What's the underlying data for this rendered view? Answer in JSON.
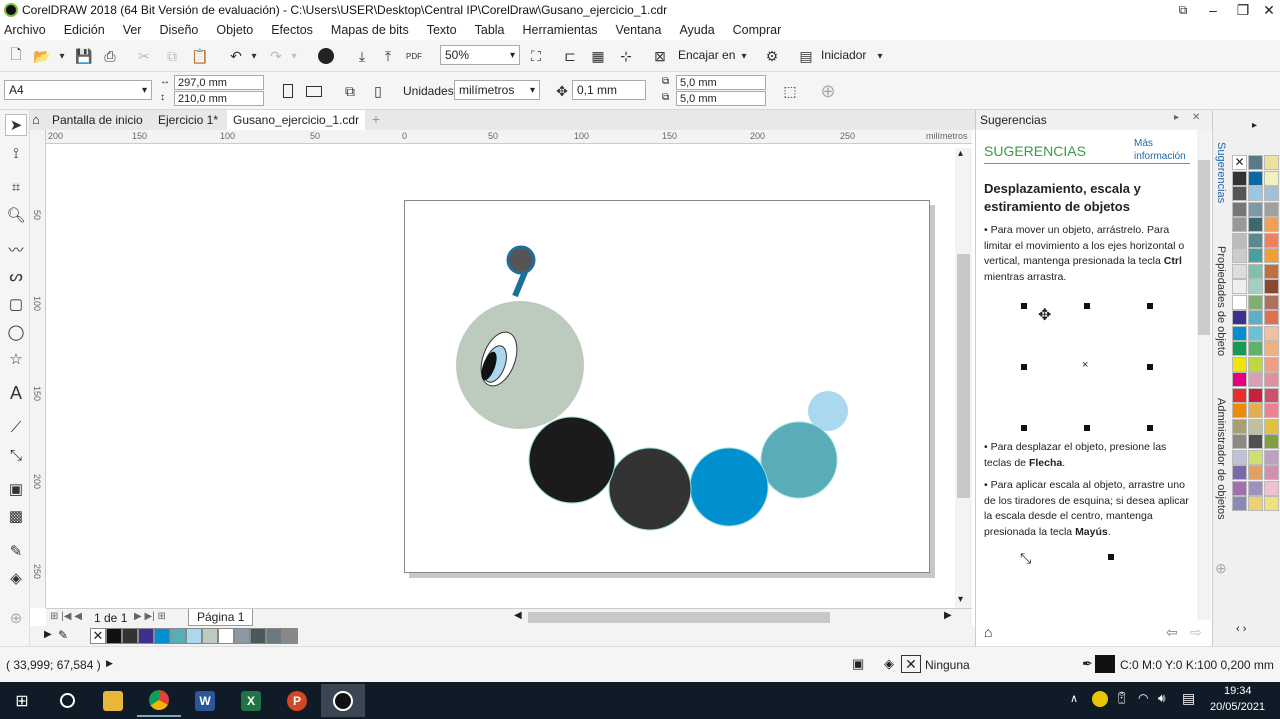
{
  "window": {
    "title": "CorelDRAW 2018 (64 Bit Versión de evaluación) - C:\\Users\\USER\\Desktop\\Central IP\\CorelDraw\\Gusano_ejercicio_1.cdr"
  },
  "menu": [
    "Archivo",
    "Edición",
    "Ver",
    "Diseño",
    "Objeto",
    "Efectos",
    "Mapas de bits",
    "Texto",
    "Tabla",
    "Herramientas",
    "Ventana",
    "Ayuda",
    "Comprar"
  ],
  "toolbar": {
    "zoom": "50%",
    "snap_label": "Encajar en",
    "launcher_label": "Iniciador"
  },
  "propbar": {
    "page_size": "A4",
    "width": "297,0 mm",
    "height": "210,0 mm",
    "units_label": "Unidades:",
    "units_value": "milímetros",
    "nudge": "0,1 mm",
    "dup_x": "5,0 mm",
    "dup_y": "5,0 mm"
  },
  "tabs": [
    {
      "label": "Pantalla de inicio"
    },
    {
      "label": "Ejercicio 1*"
    },
    {
      "label": "Gusano_ejercicio_1.cdr"
    }
  ],
  "ruler": {
    "h_ticks": [
      "200",
      "150",
      "100",
      "50",
      "0",
      "50",
      "100",
      "150",
      "200",
      "250"
    ],
    "unit": "milímetros",
    "v_ticks": [
      "50",
      "100",
      "150",
      "200",
      "250"
    ]
  },
  "pagenav": {
    "counter": "1 de 1",
    "page_tab": "Página 1"
  },
  "docker": {
    "title": "Sugerencias",
    "heading": "SUGERENCIAS",
    "more_info": "Más información",
    "topic": "Desplazamiento, escala y estiramiento de objetos",
    "p1_pre": "Para mover un objeto, arrástrelo. Para limitar el movimiento a los ejes horizontal o vertical, mantenga presionada la tecla ",
    "p1_bold": "Ctrl",
    "p1_post": " mientras arrastra.",
    "p2_pre": "Para desplazar el objeto, presione las teclas de ",
    "p2_bold": "Flecha",
    "p2_post": ".",
    "p3_pre": "Para aplicar escala al objeto, arrastre uno de los tiradores de esquina; si desea aplicar la escala desde el centro, mantenga presionada la tecla ",
    "p3_bold": "Mayús",
    "p3_post": "."
  },
  "sidetabs": [
    "Sugerencias",
    "Propiedades de objeto",
    "Administrador de objetos"
  ],
  "status": {
    "coords": "( 33,999; 67,584 )",
    "fill": "Ninguna",
    "outline": "C:0 M:0 Y:0 K:100  0,200 mm"
  },
  "taskbar": {
    "time": "19:34",
    "date": "20/05/2021"
  },
  "colors": {
    "worm_head": "#bccbbd",
    "worm_black": "#1b1b1b",
    "worm_dark": "#333333",
    "worm_blue": "#0090d0",
    "worm_teal": "#5aacb8",
    "worm_light": "#a9d8ef",
    "antenna": "#1f6e9a",
    "accent_green": "#3a9a4a"
  }
}
